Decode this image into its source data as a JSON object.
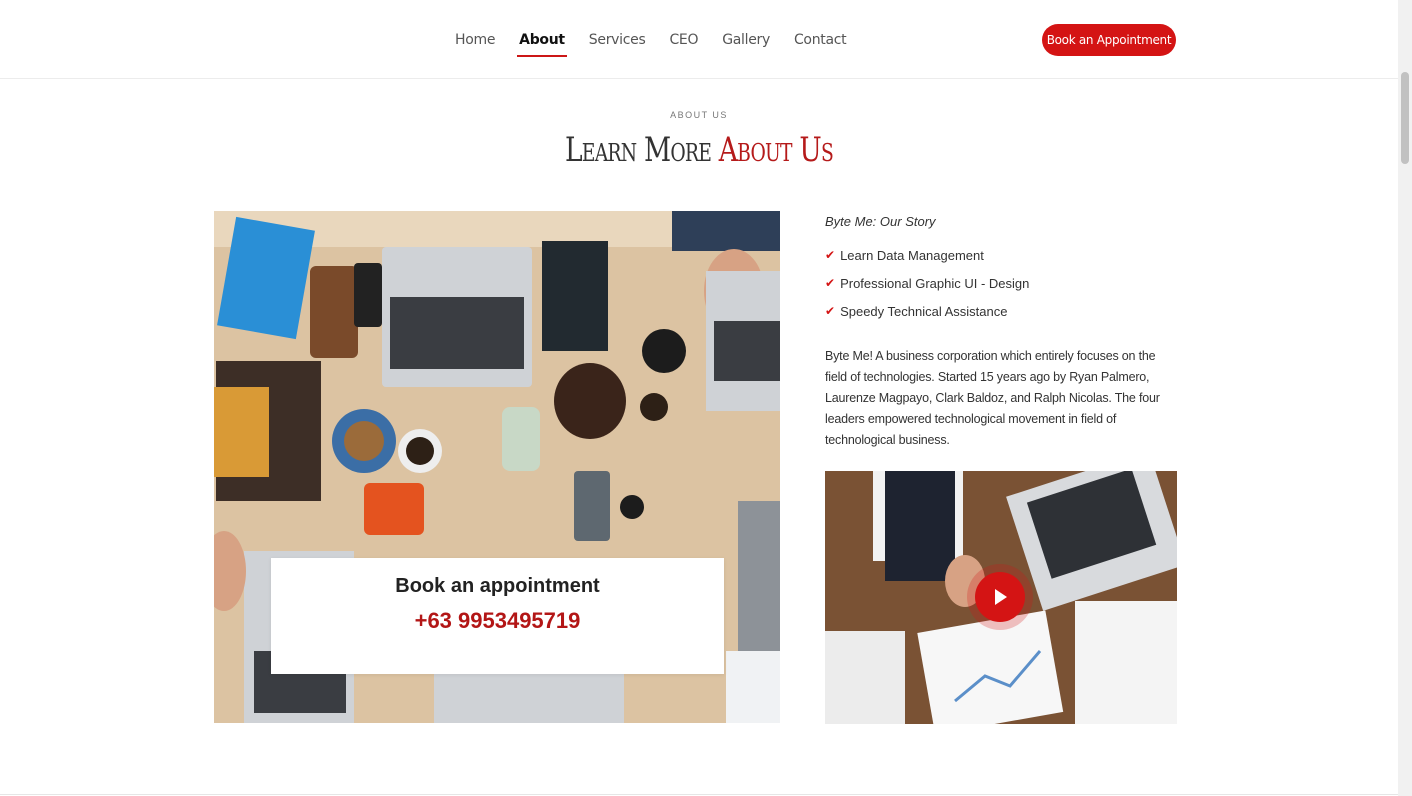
{
  "nav": {
    "items": [
      {
        "label": "Home",
        "active": false
      },
      {
        "label": "About",
        "active": true
      },
      {
        "label": "Services",
        "active": false
      },
      {
        "label": "CEO",
        "active": false
      },
      {
        "label": "Gallery",
        "active": false
      },
      {
        "label": "Contact",
        "active": false
      }
    ],
    "cta_label": "Book an Appointment"
  },
  "section": {
    "kicker": "ABOUT US",
    "title_part1": "Learn More ",
    "title_part2": "About Us"
  },
  "appointment": {
    "title": "Book an appointment",
    "phone": "+63 9953495719"
  },
  "story": {
    "heading": "Byte Me: Our Story",
    "checklist": [
      "Learn Data Management",
      "Professional Graphic UI - Design",
      "Speedy Technical Assistance"
    ],
    "description": "Byte Me! A business corporation which entirely focuses on the field of technologies. Started 15 years ago by Ryan Palmero, Laurenze Magpayo, Clark Baldoz, and Ralph Nicolas. The four leaders empowered technological movement in field of technological business."
  },
  "colors": {
    "accent": "#d41414"
  }
}
